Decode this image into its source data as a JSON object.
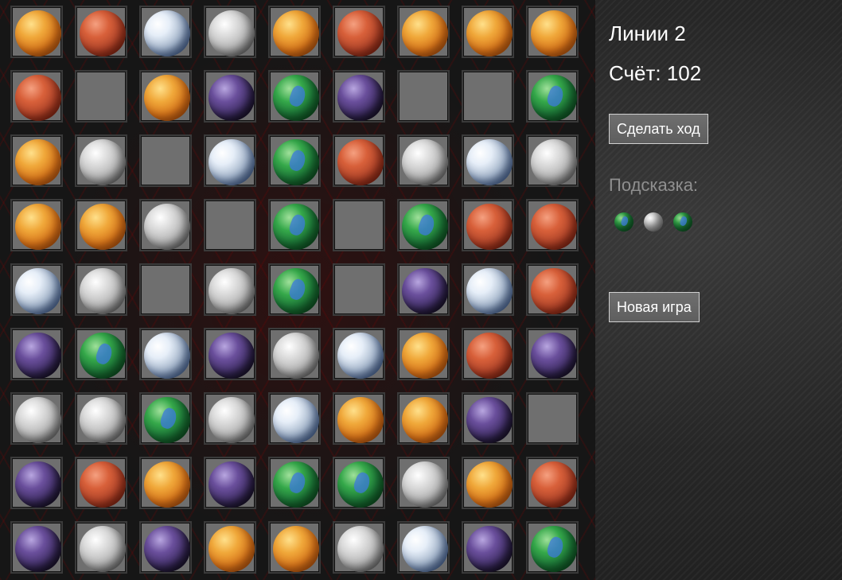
{
  "board": {
    "rows": [
      [
        "venus",
        "mars",
        "earthmoon",
        "moon",
        "venus",
        "mars",
        "venus",
        "venus",
        "venus"
      ],
      [
        "mars",
        "empty",
        "venus",
        "purple",
        "earth",
        "purple",
        "empty",
        "empty",
        "earth"
      ],
      [
        "venus",
        "moon",
        "empty",
        "earthmoon",
        "earth",
        "mars",
        "moon",
        "earthmoon",
        "moon"
      ],
      [
        "venus",
        "venus",
        "moon",
        "empty",
        "earth",
        "empty",
        "earth",
        "mars",
        "mars"
      ],
      [
        "earthmoon",
        "moon",
        "empty",
        "moon",
        "earth",
        "empty",
        "purple",
        "earthmoon",
        "mars"
      ],
      [
        "purple",
        "earth",
        "earthmoon",
        "purple",
        "moon",
        "earthmoon",
        "venus",
        "mars",
        "purple"
      ],
      [
        "moon",
        "moon",
        "earth",
        "moon",
        "earthmoon",
        "venus",
        "venus",
        "purple",
        "empty"
      ],
      [
        "purple",
        "mars",
        "venus",
        "purple",
        "earth",
        "earth",
        "moon",
        "venus",
        "mars"
      ],
      [
        "purple",
        "moon",
        "purple",
        "venus",
        "venus",
        "moon",
        "earthmoon",
        "purple",
        "earth"
      ]
    ]
  },
  "panel": {
    "lines_text": "Линии 2",
    "score_text": "Счёт: 102",
    "move_button": "Сделать ход",
    "hint_label": "Подсказка:",
    "hint_balls": [
      "earth",
      "moon",
      "earth"
    ],
    "new_game_button": "Новая игра"
  }
}
